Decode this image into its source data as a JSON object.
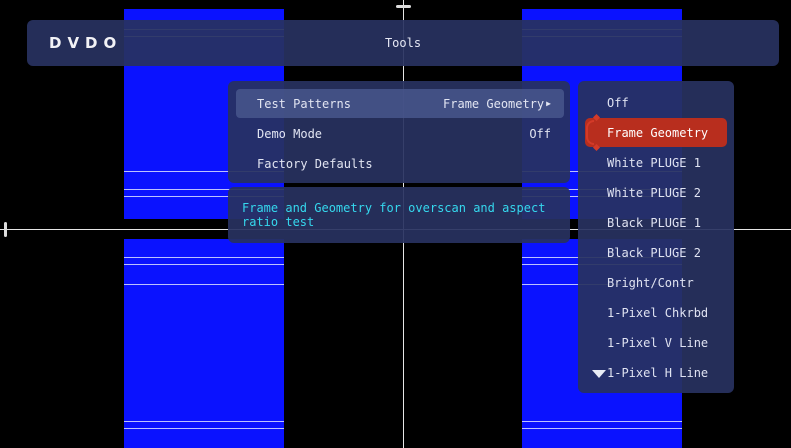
{
  "header": {
    "logo": "DVDO",
    "title": "Tools"
  },
  "menu": {
    "items": [
      {
        "label": "Test Patterns",
        "value": "Frame Geometry",
        "has_submenu": true,
        "selected": true
      },
      {
        "label": "Demo Mode",
        "value": "Off",
        "has_submenu": false,
        "selected": false
      },
      {
        "label": "Factory Defaults",
        "value": "",
        "has_submenu": false,
        "selected": false
      }
    ]
  },
  "description": "Frame and Geometry for overscan and aspect ratio test",
  "submenu": {
    "items": [
      "Off",
      "Frame Geometry",
      "White PLUGE 1",
      "White PLUGE 2",
      "Black PLUGE 1",
      "Black PLUGE 2",
      "Bright/Contr",
      "1-Pixel Chkrbd",
      "1-Pixel V Line",
      "1-Pixel H Line"
    ],
    "active_index": 1,
    "more_icon": "chevron-down-icon"
  },
  "colors": {
    "background": "#000000",
    "pattern_blue": "#0a12ff",
    "panel": "#283260",
    "highlight": "#b82e1e",
    "description_text": "#35d8ee"
  }
}
